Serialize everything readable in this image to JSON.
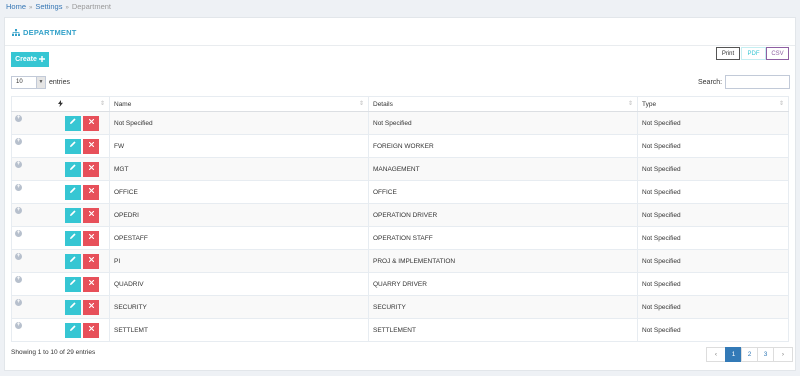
{
  "breadcrumb": {
    "home": "Home",
    "settings": "Settings",
    "current": "Department"
  },
  "title": "DEPARTMENT",
  "toolbar": {
    "create_label": "Create",
    "print_label": "Print",
    "pdf_label": "PDF",
    "csv_label": "CSV"
  },
  "length": {
    "value": "10",
    "label": "entries"
  },
  "search": {
    "label": "Search:",
    "value": ""
  },
  "columns": {
    "bolt": "",
    "name": "Name",
    "details": "Details",
    "type": "Type"
  },
  "rows": [
    {
      "name": "Not Specified",
      "details": "Not Specified",
      "type": "Not Specified"
    },
    {
      "name": "FW",
      "details": "FOREIGN WORKER",
      "type": "Not Specified"
    },
    {
      "name": "MGT",
      "details": "MANAGEMENT",
      "type": "Not Specified"
    },
    {
      "name": "OFFICE",
      "details": "OFFICE",
      "type": "Not Specified"
    },
    {
      "name": "OPEDRI",
      "details": "OPERATION DRIVER",
      "type": "Not Specified"
    },
    {
      "name": "OPESTAFF",
      "details": "OPERATION STAFF",
      "type": "Not Specified"
    },
    {
      "name": "PI",
      "details": "PROJ & IMPLEMENTATION",
      "type": "Not Specified"
    },
    {
      "name": "QUADRIV",
      "details": "QUARRY DRIVER",
      "type": "Not Specified"
    },
    {
      "name": "SECURITY",
      "details": "SECURITY",
      "type": "Not Specified"
    },
    {
      "name": "SETTLEMT",
      "details": "SETTLEMENT",
      "type": "Not Specified"
    }
  ],
  "info": "Showing 1 to 10 of 29 entries",
  "pagination": {
    "prev": "‹",
    "pages": [
      "1",
      "2",
      "3"
    ],
    "next": "›",
    "active": "1"
  },
  "colors": {
    "accent": "#36c6d3",
    "danger": "#e7505a",
    "title": "#33a1c9",
    "primary": "#337ab7"
  }
}
